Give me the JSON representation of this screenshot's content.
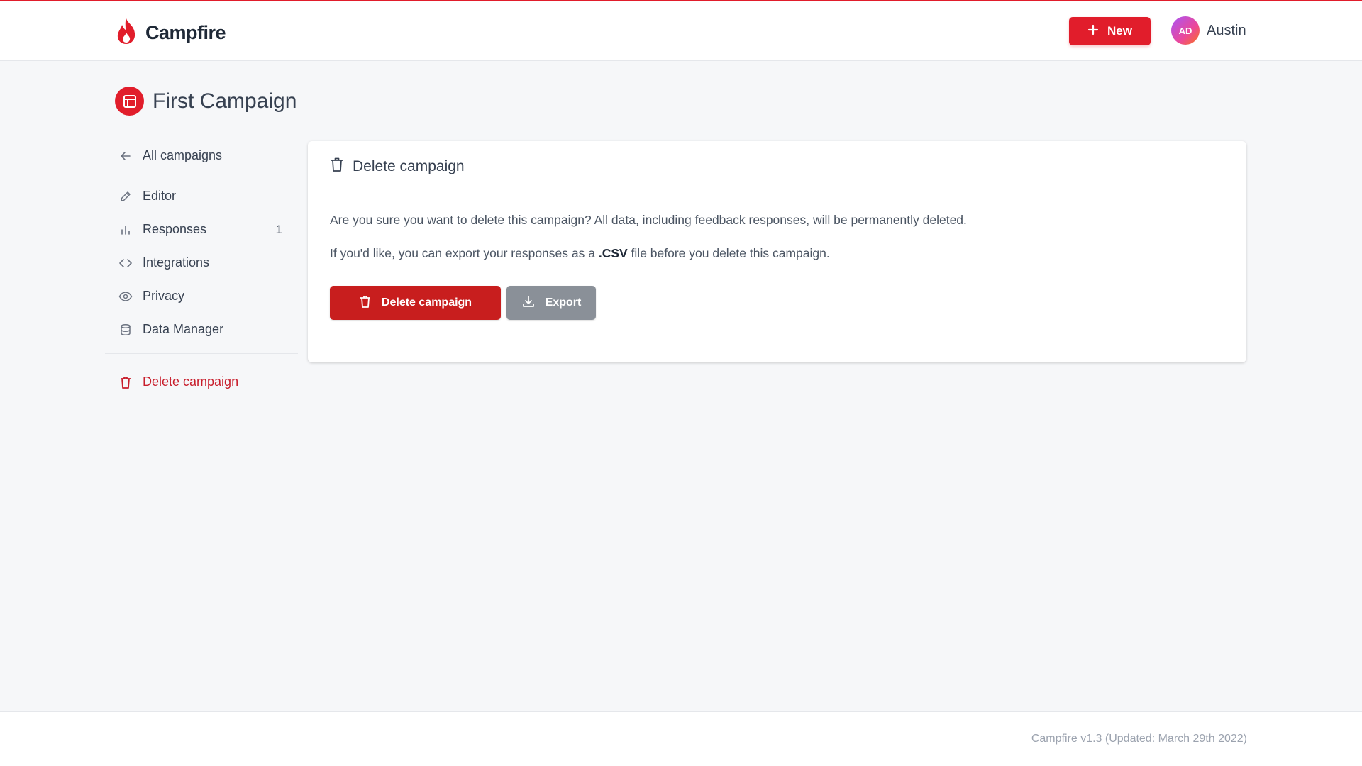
{
  "app": {
    "name": "Campfire"
  },
  "header": {
    "new_label": "New",
    "user": {
      "name": "Austin",
      "avatar_initials": "AD"
    }
  },
  "page": {
    "title": "First Campaign"
  },
  "sidebar": {
    "items": [
      {
        "label": "All campaigns",
        "icon": "arrow-left-icon"
      },
      {
        "label": "Editor",
        "icon": "pencil-icon"
      },
      {
        "label": "Responses",
        "icon": "bar-chart-icon",
        "count": "1"
      },
      {
        "label": "Integrations",
        "icon": "code-icon"
      },
      {
        "label": "Privacy",
        "icon": "eye-icon"
      },
      {
        "label": "Data Manager",
        "icon": "database-icon"
      }
    ],
    "delete_label": "Delete campaign"
  },
  "card": {
    "title": "Delete campaign",
    "message": "Are you sure you want to delete this campaign? All data, including feedback responses, will be permanently deleted.",
    "export_prefix": "If you'd like, you can export your responses as a ",
    "export_format": ".CSV",
    "export_suffix": " file before you delete this campaign.",
    "delete_button": "Delete campaign",
    "export_button": "Export"
  },
  "footer": {
    "version": "Campfire v1.3 (Updated: March 29th 2022)"
  },
  "colors": {
    "accent": "#e11d2b",
    "danger": "#c81e1e",
    "secondary": "#8a9098",
    "background": "#f6f7f9"
  }
}
